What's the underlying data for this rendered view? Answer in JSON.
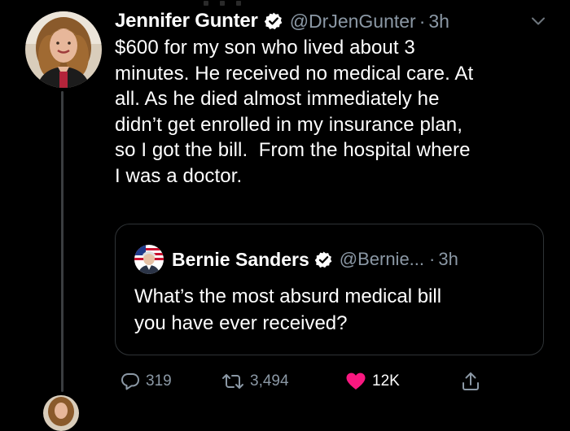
{
  "tweet": {
    "author_name": "Jennifer Gunter",
    "handle": "@DrJenGunter",
    "separator": "·",
    "time": "3h",
    "verified_icon": "verified-badge-icon",
    "menu_icon": "chevron-down-icon",
    "text": "$600 for my son who lived about 3\nminutes. He received no medical care. At\nall. As he died almost immediately he\ndidn’t get enrolled in my insurance plan,\nso I got the bill.  From the hospital where\nI was a doctor."
  },
  "quote": {
    "author_name": "Bernie Sanders",
    "handle": "@Bernie...",
    "separator": "·",
    "time": "3h",
    "text": "What’s the most absurd medical bill\nyou have ever received?"
  },
  "actions": {
    "reply_count": "319",
    "retweet_count": "3,494",
    "like_count": "12K",
    "reply_icon": "reply-icon",
    "retweet_icon": "retweet-icon",
    "like_icon": "heart-icon",
    "share_icon": "share-icon"
  },
  "colors": {
    "background": "#000000",
    "text": "#ffffff",
    "secondary_text": "#8b98a5",
    "verified": "#ffffff",
    "like": "#f91880",
    "border": "#2f3336"
  }
}
